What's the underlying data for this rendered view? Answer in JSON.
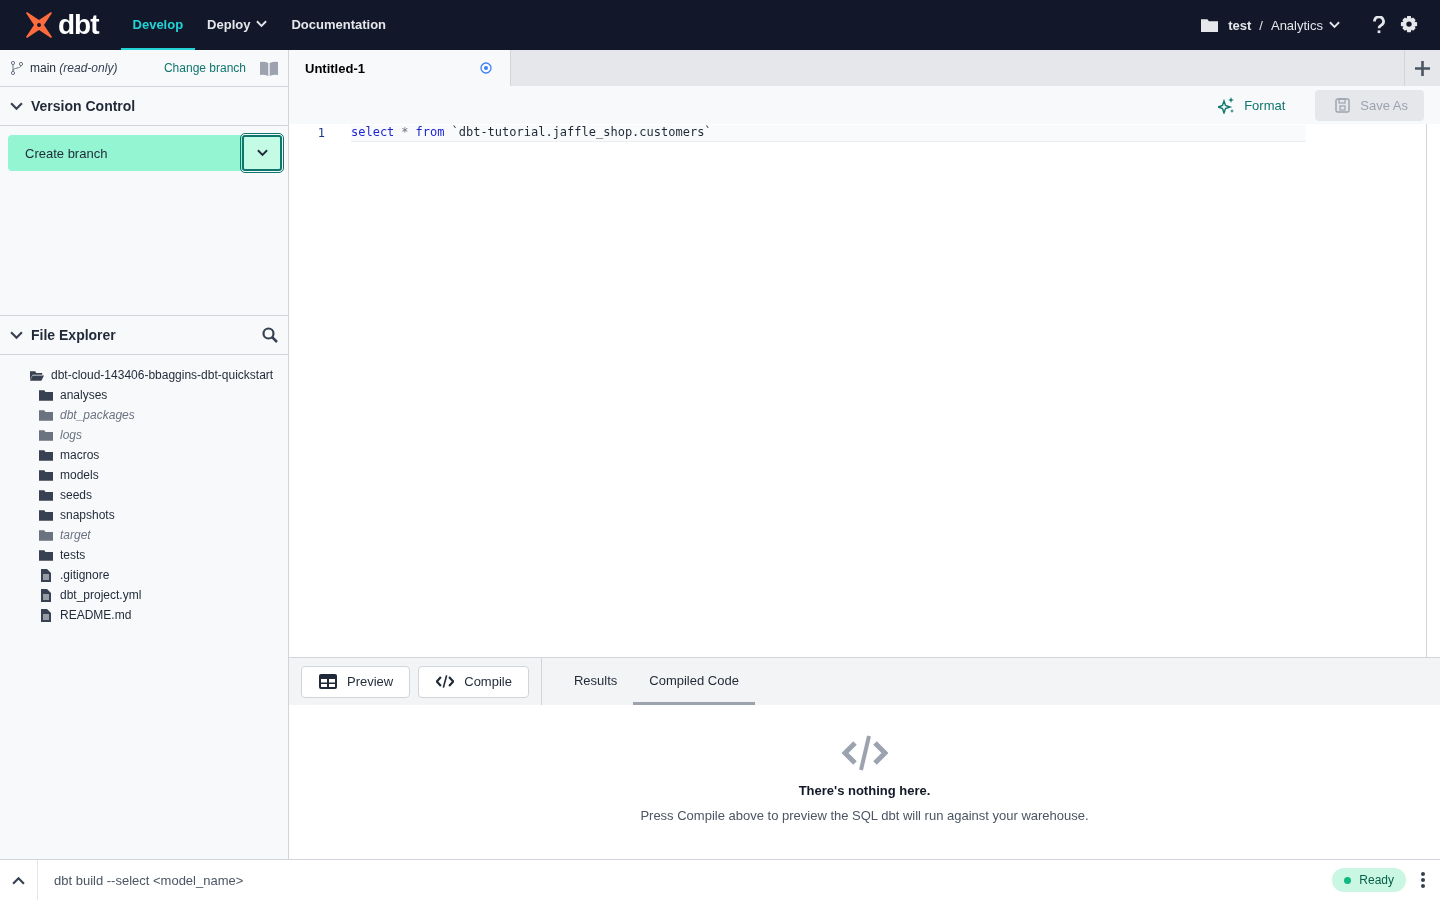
{
  "nav": {
    "logo": "dbt",
    "items": [
      {
        "label": "Develop",
        "selected": true,
        "dropdown": false
      },
      {
        "label": "Deploy",
        "selected": false,
        "dropdown": true
      },
      {
        "label": "Documentation",
        "selected": false,
        "dropdown": false
      }
    ],
    "project": {
      "folder": "test",
      "separator": "/",
      "environment": "Analytics"
    }
  },
  "sidebar": {
    "branch": {
      "name": "main",
      "note": "(read-only)",
      "action": "Change branch"
    },
    "version_control": {
      "title": "Version Control",
      "expanded": true,
      "button": "Create branch"
    },
    "file_explorer": {
      "title": "File Explorer",
      "expanded": true,
      "tree": [
        {
          "name": "dbt-cloud-143406-bbaggins-dbt-quickstart",
          "kind": "folder",
          "ignored": false,
          "expanded": true,
          "children": [
            {
              "name": "analyses",
              "kind": "folder",
              "ignored": false
            },
            {
              "name": "dbt_packages",
              "kind": "folder",
              "ignored": true
            },
            {
              "name": "logs",
              "kind": "folder",
              "ignored": true
            },
            {
              "name": "macros",
              "kind": "folder",
              "ignored": false
            },
            {
              "name": "models",
              "kind": "folder",
              "ignored": false
            },
            {
              "name": "seeds",
              "kind": "folder",
              "ignored": false
            },
            {
              "name": "snapshots",
              "kind": "folder",
              "ignored": false
            },
            {
              "name": "target",
              "kind": "folder",
              "ignored": true
            },
            {
              "name": "tests",
              "kind": "folder",
              "ignored": false
            },
            {
              "name": ".gitignore",
              "kind": "file",
              "ignored": false
            },
            {
              "name": "dbt_project.yml",
              "kind": "file",
              "ignored": false
            },
            {
              "name": "README.md",
              "kind": "file",
              "ignored": false
            }
          ]
        }
      ]
    }
  },
  "editor": {
    "tabs": [
      {
        "label": "Untitled-1",
        "selected": true
      }
    ],
    "toolbar": {
      "format": "Format",
      "save_as": {
        "label": "Save As",
        "disabled": true
      }
    },
    "lines": [
      {
        "number": "1",
        "tokens": [
          {
            "kind": "keyword",
            "text": "select"
          },
          {
            "kind": "operator",
            "text": "*"
          },
          {
            "kind": "keyword",
            "text": "from"
          },
          {
            "kind": "string",
            "text": "`dbt-tutorial.jaffle_shop.customers`"
          }
        ]
      }
    ]
  },
  "results": {
    "actions": [
      {
        "label": "Preview",
        "kind": "preview"
      },
      {
        "label": "Compile",
        "kind": "compile"
      }
    ],
    "tabs": [
      {
        "label": "Results",
        "selected": false
      },
      {
        "label": "Compiled Code",
        "selected": true
      }
    ],
    "empty": {
      "title": "There's nothing here.",
      "message": "Press Compile above to preview the SQL dbt will run against your warehouse."
    }
  },
  "status_bar": {
    "command_placeholder": "dbt build --select <model_name>",
    "status": {
      "label": "Ready",
      "color": "#10b981"
    }
  }
}
